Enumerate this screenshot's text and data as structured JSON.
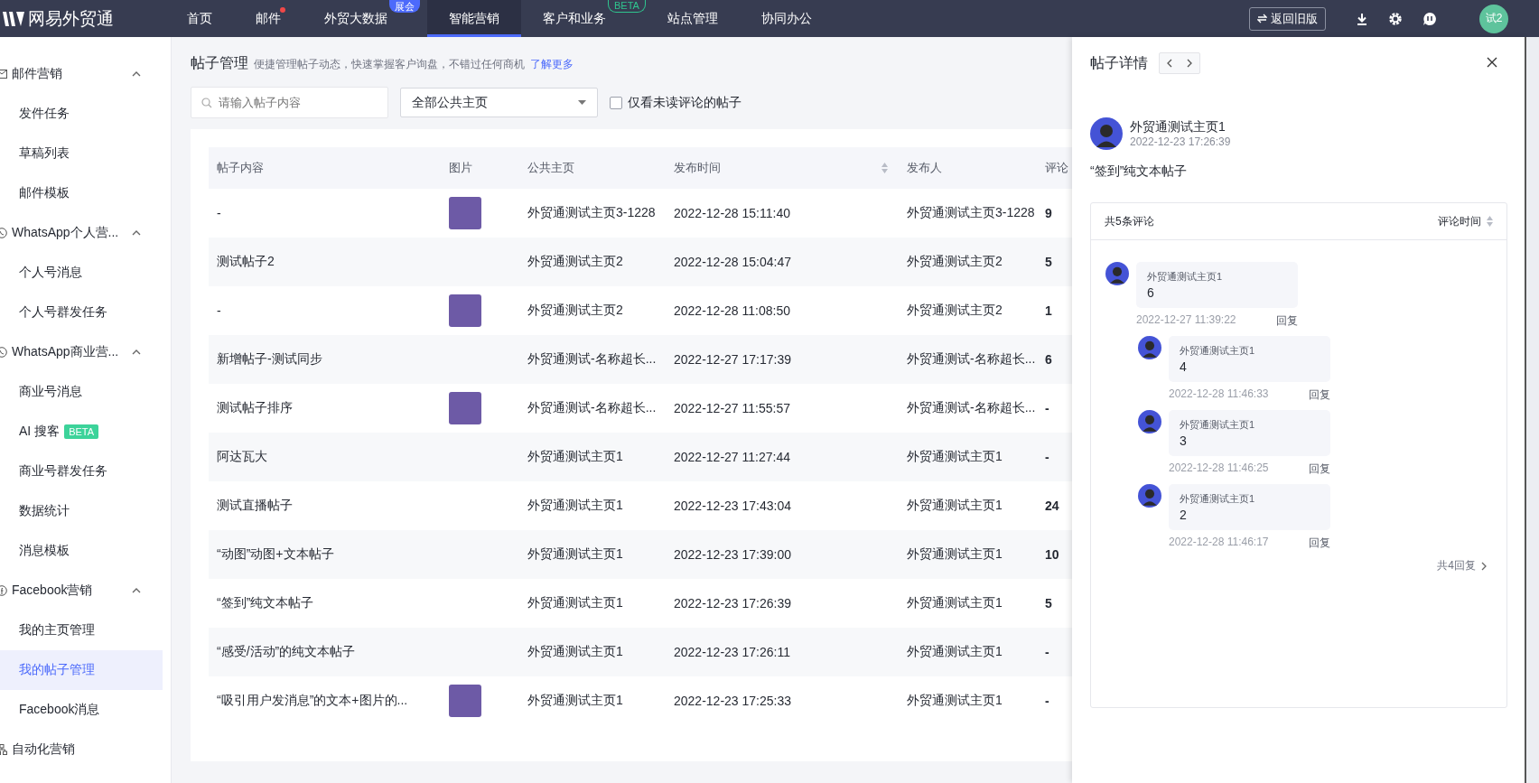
{
  "app": {
    "logo_text": "网易外贸通"
  },
  "nav": [
    {
      "label": "首页",
      "selected": false,
      "dot": false
    },
    {
      "label": "邮件",
      "selected": false,
      "dot": true
    },
    {
      "label": "外贸大数据",
      "selected": false,
      "dot": false,
      "badge": {
        "text": "展会",
        "kind": "filled"
      }
    },
    {
      "label": "智能营销",
      "selected": true,
      "dot": false
    },
    {
      "label": "客户和业务",
      "selected": false,
      "dot": false,
      "badge": {
        "text": "BETA",
        "kind": "outline"
      }
    },
    {
      "label": "站点管理",
      "selected": false,
      "dot": false
    },
    {
      "label": "协同办公",
      "selected": false,
      "dot": false
    }
  ],
  "header_actions": {
    "back_button": "返回旧版",
    "avatar": "试2"
  },
  "sidebar": {
    "groups": [
      {
        "label": "邮件营销",
        "kind": "mail",
        "expanded": true,
        "items": [
          {
            "label": "发件任务",
            "selected": false
          },
          {
            "label": "草稿列表",
            "selected": false
          },
          {
            "label": "邮件模板",
            "selected": false
          }
        ]
      },
      {
        "label": "WhatsApp个人营...",
        "kind": "whatsapp",
        "expanded": true,
        "items": [
          {
            "label": "个人号消息",
            "selected": false
          },
          {
            "label": "个人号群发任务",
            "selected": false
          }
        ]
      },
      {
        "label": "WhatsApp商业营...",
        "kind": "whatsapp",
        "expanded": true,
        "items": [
          {
            "label": "商业号消息",
            "selected": false
          },
          {
            "label": "AI 搜客",
            "selected": false,
            "badge": "BETA"
          },
          {
            "label": "商业号群发任务",
            "selected": false
          },
          {
            "label": "数据统计",
            "selected": false
          },
          {
            "label": "消息模板",
            "selected": false
          }
        ]
      },
      {
        "label": "Facebook营销",
        "kind": "facebook",
        "expanded": true,
        "items": [
          {
            "label": "我的主页管理",
            "selected": false
          },
          {
            "label": "我的帖子管理",
            "selected": true
          },
          {
            "label": "Facebook消息",
            "selected": false
          }
        ]
      },
      {
        "label": "自动化营销",
        "kind": "flow"
      }
    ]
  },
  "page": {
    "title": "帖子管理",
    "subtitle": "便捷管理帖子动态，快速掌握客户询盘，不错过任何商机",
    "link": "了解更多",
    "search": {
      "placeholder": "请输入帖子内容"
    },
    "filter": {
      "value": "全部公共主页"
    },
    "unread_only": {
      "label": "仅看未读评论的帖子",
      "checked": false
    }
  },
  "table": {
    "columns": [
      {
        "label": "帖子内容",
        "sortable": false
      },
      {
        "label": "图片",
        "sortable": false
      },
      {
        "label": "公共主页",
        "sortable": false
      },
      {
        "label": "发布时间",
        "sortable": true
      },
      {
        "label": "发布人",
        "sortable": false
      },
      {
        "label": "评论"
      }
    ],
    "rows": [
      {
        "content": "-",
        "image": true,
        "page": "外贸通测试主页3-1228",
        "time": "2022-12-28 15:11:40",
        "publisher": "外贸通测试主页3-1228",
        "comments": "9"
      },
      {
        "content": "测试帖子2",
        "image": false,
        "page": "外贸通测试主页2",
        "time": "2022-12-28 15:04:47",
        "publisher": "外贸通测试主页2",
        "comments": "5"
      },
      {
        "content": "-",
        "image": true,
        "page": "外贸通测试主页2",
        "time": "2022-12-28 11:08:50",
        "publisher": "外贸通测试主页2",
        "comments": "1"
      },
      {
        "content": "新增帖子-测试同步",
        "image": false,
        "page": "外贸通测试-名称超长...",
        "time": "2022-12-27 17:17:39",
        "publisher": "外贸通测试-名称超长...",
        "comments": "6"
      },
      {
        "content": "测试帖子排序",
        "image": true,
        "page": "外贸通测试-名称超长...",
        "time": "2022-12-27 11:55:57",
        "publisher": "外贸通测试-名称超长...",
        "comments": "-"
      },
      {
        "content": "阿达瓦大",
        "image": false,
        "page": "外贸通测试主页1",
        "time": "2022-12-27 11:27:44",
        "publisher": "外贸通测试主页1",
        "comments": "-"
      },
      {
        "content": "测试直播帖子",
        "image": false,
        "page": "外贸通测试主页1",
        "time": "2022-12-23 17:43:04",
        "publisher": "外贸通测试主页1",
        "comments": "24"
      },
      {
        "content": "“动图”动图+文本帖子",
        "image": false,
        "page": "外贸通测试主页1",
        "time": "2022-12-23 17:39:00",
        "publisher": "外贸通测试主页1",
        "comments": "10"
      },
      {
        "content": "“签到”纯文本帖子",
        "image": false,
        "page": "外贸通测试主页1",
        "time": "2022-12-23 17:26:39",
        "publisher": "外贸通测试主页1",
        "comments": "5"
      },
      {
        "content": "“感受/活动”的纯文本帖子",
        "image": false,
        "page": "外贸通测试主页1",
        "time": "2022-12-23 17:26:11",
        "publisher": "外贸通测试主页1",
        "comments": "-"
      },
      {
        "content": "“吸引用户发消息”的文本+图片的...",
        "image": true,
        "page": "外贸通测试主页1",
        "time": "2022-12-23 17:25:33",
        "publisher": "外贸通测试主页1",
        "comments": "-"
      }
    ]
  },
  "detail": {
    "title": "帖子详情",
    "author": "外贸通测试主页1",
    "time": "2022-12-23 17:26:39",
    "text": "“签到”纯文本帖子",
    "comment_count": "共5条评论",
    "sort_label": "评论时间",
    "comments": [
      {
        "author": "外贸通测试主页1",
        "text": "6",
        "time": "2022-12-27 11:39:22",
        "reply": "回复",
        "children": [
          {
            "author": "外贸通测试主页1",
            "text": "4",
            "time": "2022-12-28 11:46:33",
            "reply": "回复"
          },
          {
            "author": "外贸通测试主页1",
            "text": "3",
            "time": "2022-12-28 11:46:25",
            "reply": "回复"
          },
          {
            "author": "外贸通测试主页1",
            "text": "2",
            "time": "2022-12-28 11:46:17",
            "reply": "回复"
          }
        ]
      }
    ],
    "more_replies": "共4回复"
  }
}
